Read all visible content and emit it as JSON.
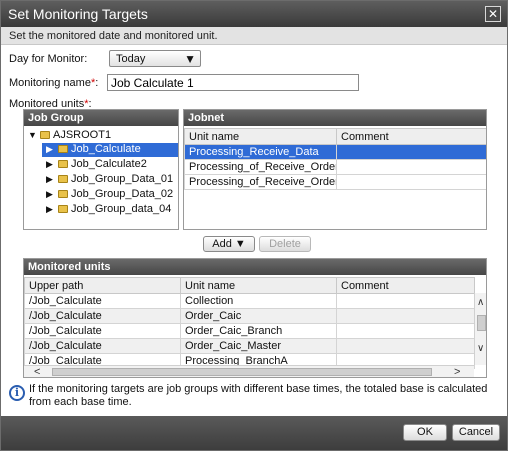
{
  "window": {
    "title": "Set Monitoring Targets",
    "subtitle": "Set the monitored date and monitored unit."
  },
  "form": {
    "day_label": "Day for Monitor:",
    "day_value": "Today",
    "name_label": "Monitoring name",
    "name_value": "Job Calculate 1",
    "units_label": "Monitored units",
    "required_mark": "*",
    "colon": ":"
  },
  "job_group": {
    "header": "Job Group",
    "root": "AJSROOT1",
    "items": [
      "Job_Calculate",
      "Job_Calculate2",
      "Job_Group_Data_01",
      "Job_Group_Data_02",
      "Job_Group_data_04"
    ],
    "selected_index": 0
  },
  "jobnet": {
    "header": "Jobnet",
    "columns": [
      "Unit name",
      "Comment"
    ],
    "rows": [
      [
        "Processing_Receive_Data",
        ""
      ],
      [
        "Processing_of_Receive_OrderA",
        ""
      ],
      [
        "Processing_of_Receive_OrderB",
        ""
      ]
    ],
    "selected_index": 0
  },
  "actions": {
    "add_label": "Add",
    "delete_label": "Delete"
  },
  "monitored_units": {
    "header": "Monitored units",
    "columns": [
      "Upper path",
      "Unit name",
      "Comment"
    ],
    "rows": [
      [
        "/Job_Calculate",
        "Collection",
        ""
      ],
      [
        "/Job_Calculate",
        "Order_Caic",
        ""
      ],
      [
        "/Job_Calculate",
        "Order_Caic_Branch",
        ""
      ],
      [
        "/Job_Calculate",
        "Order_Caic_Master",
        ""
      ],
      [
        "/Job_Calculate",
        "Processing_BranchA",
        ""
      ]
    ]
  },
  "info": {
    "text": "If the monitoring targets are job groups with different base times, the totaled base is calculated from each base time."
  },
  "footer": {
    "ok_label": "OK",
    "cancel_label": "Cancel"
  },
  "icons": {
    "close": "close-icon",
    "info": "info-icon",
    "folder": "folder-icon"
  },
  "colors": {
    "selection": "#2f6bd6",
    "required": "#d00000",
    "titlebar": "#3a3a3a"
  }
}
